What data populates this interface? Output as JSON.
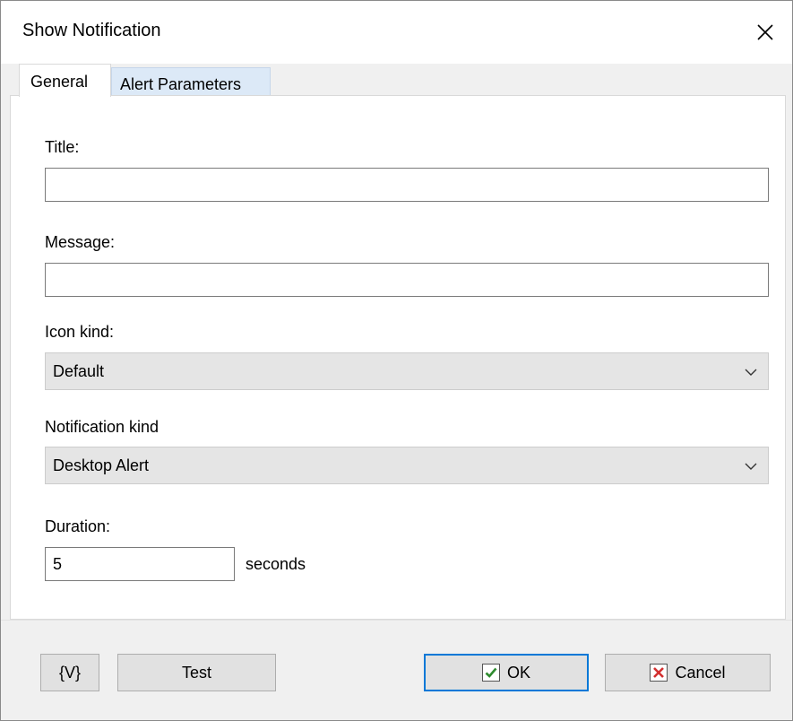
{
  "window": {
    "title": "Show Notification"
  },
  "tabs": [
    {
      "label": "General",
      "active": true
    },
    {
      "label": "Alert Parameters",
      "active": false
    }
  ],
  "fields": {
    "title": {
      "label": "Title:",
      "value": ""
    },
    "message": {
      "label": "Message:",
      "value": ""
    },
    "icon_kind": {
      "label": "Icon kind:",
      "value": "Default"
    },
    "notification_kind": {
      "label": "Notification kind",
      "value": "Desktop Alert"
    },
    "duration": {
      "label": "Duration:",
      "value": "5",
      "unit": "seconds"
    }
  },
  "buttons": {
    "variables": "{V}",
    "test": "Test",
    "ok": "OK",
    "cancel": "Cancel"
  },
  "icons": {
    "close": "close-icon",
    "dropdown": "chevron-down-icon",
    "ok": "checkmark-icon",
    "cancel": "x-mark-icon"
  },
  "colors": {
    "accent": "#0078d7",
    "ok_check": "#2e8b2e",
    "cancel_x": "#d32f2f",
    "inactive_tab": "#dce9f7"
  }
}
